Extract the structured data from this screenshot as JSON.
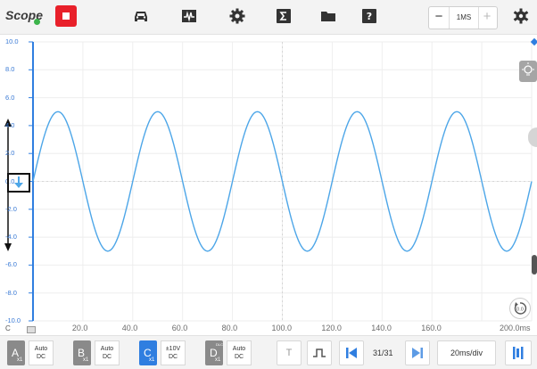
{
  "app": {
    "title": "Scope"
  },
  "toolbar": {
    "icons": [
      "car-icon",
      "waveform-icon",
      "gear-icon",
      "sigma-icon",
      "folder-icon",
      "help-icon",
      "settings-icon"
    ],
    "sample_rate": {
      "minus": "−",
      "value": "1MS",
      "plus": "+"
    }
  },
  "plot": {
    "y_ticks": [
      "10.0",
      "8.0",
      "6.0",
      "4.0",
      "2.0",
      "0.0",
      "-2.0",
      "-4.0",
      "-6.0",
      "-8.0",
      "-10.0"
    ],
    "x_ticks": [
      "20.0",
      "40.0",
      "60.0",
      "80.0",
      "100.0",
      "120.0",
      "140.0",
      "160.0",
      "200.0ms"
    ],
    "channel_marker": "C",
    "trace_color": "#4da6e8",
    "axis_color": "#2f7ee0",
    "waveform": {
      "type": "sine",
      "amplitude": 5.0,
      "period_ms": 40,
      "offset": 0.0,
      "x_range_ms": [
        0,
        200
      ],
      "y_range": [
        -10,
        10
      ]
    }
  },
  "channels": [
    {
      "letter": "A",
      "mult": "x1",
      "range": "Auto",
      "coupling": "DC",
      "color": "#8a8a8a",
      "active": false
    },
    {
      "letter": "B",
      "mult": "x1",
      "range": "Auto",
      "coupling": "DC",
      "color": "#8a8a8a",
      "active": false
    },
    {
      "letter": "C",
      "mult": "x1",
      "range": "±10V",
      "coupling": "DC",
      "color": "#2f7ee0",
      "active": true
    },
    {
      "letter": "D",
      "mult": "x1",
      "range": "Auto",
      "coupling": "DC",
      "color": "#8a8a8a",
      "active": false,
      "tag": "DLC"
    }
  ],
  "bottom": {
    "trigger_label": "T",
    "page": "31/31",
    "timebase": "20ms/div"
  }
}
